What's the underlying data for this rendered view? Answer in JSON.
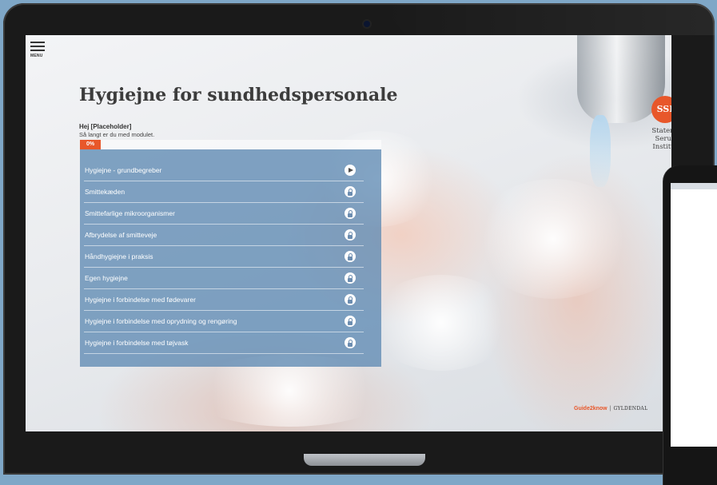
{
  "app": {
    "menu_label": "MENU",
    "title": "Hygiejne for sundhedspersonale"
  },
  "user": {
    "greeting": "Hej [Placeholder]",
    "subtitle": "Så langt er du med modulet.",
    "progress_percent_label": "0%",
    "progress_value": 0
  },
  "modules": [
    {
      "label": "Hygiejne - grundbegreber",
      "icon": "play-icon"
    },
    {
      "label": "Smittekæden",
      "icon": "lock-icon"
    },
    {
      "label": "Smittefarlige mikroorganismer",
      "icon": "lock-icon"
    },
    {
      "label": "Afbrydelse af smitteveje",
      "icon": "lock-icon"
    },
    {
      "label": "Håndhygiejne i praksis",
      "icon": "lock-icon"
    },
    {
      "label": "Egen hygiejne",
      "icon": "lock-icon"
    },
    {
      "label": "Hygiejne i forbindelse med fødevarer",
      "icon": "lock-icon"
    },
    {
      "label": "Hygiejne i forbindelse med oprydning og rengøring",
      "icon": "lock-icon"
    },
    {
      "label": "Hygiejne i forbindelse med tøjvask",
      "icon": "lock-icon"
    }
  ],
  "logo": {
    "abbr": "SSI",
    "line1": "Statens",
    "line2": "Serum",
    "line3": "Institut"
  },
  "footer": {
    "brand": "Guide2know",
    "separator": "|",
    "publisher": "GYLDENDAL"
  },
  "colors": {
    "accent": "#e8572a",
    "panel": "#5f8ab4",
    "background": "#7fa7c7"
  }
}
